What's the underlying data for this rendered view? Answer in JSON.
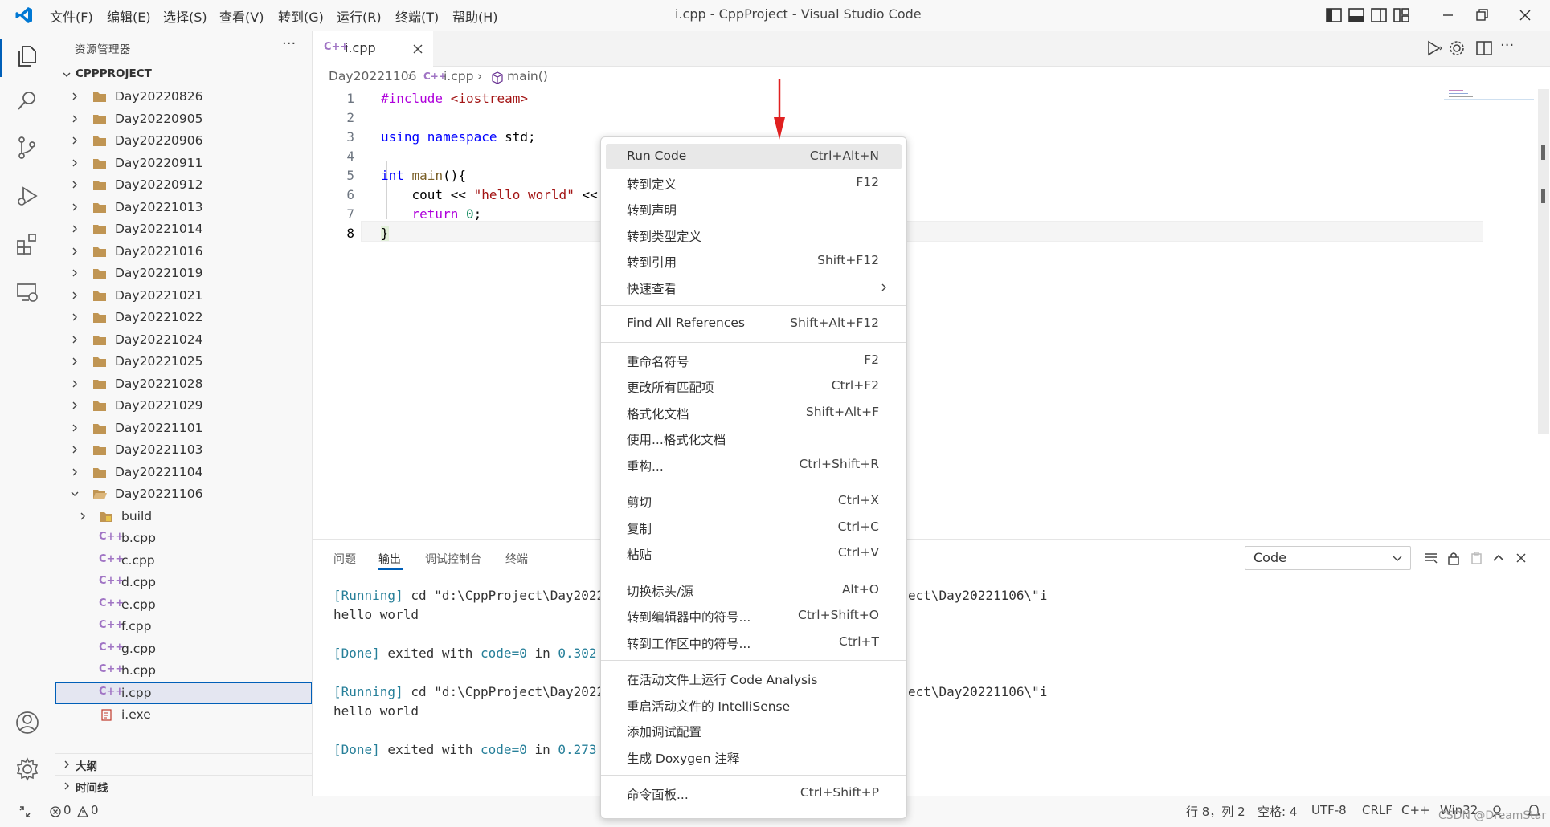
{
  "titlebar": {
    "title": "i.cpp - CppProject - Visual Studio Code",
    "menu": [
      "文件(F)",
      "编辑(E)",
      "选择(S)",
      "查看(V)",
      "转到(G)",
      "运行(R)",
      "终端(T)",
      "帮助(H)"
    ]
  },
  "sidebar": {
    "title": "资源管理器",
    "more": "···",
    "root": "CPPPROJECT",
    "folders": [
      "Day20220826",
      "Day20220905",
      "Day20220906",
      "Day20220911",
      "Day20220912",
      "Day20221013",
      "Day20221014",
      "Day20221016",
      "Day20221019",
      "Day20221021",
      "Day20221022",
      "Day20221024",
      "Day20221025",
      "Day20221028",
      "Day20221029",
      "Day20221101",
      "Day20221103",
      "Day20221104"
    ],
    "open_folder": "Day20221106",
    "build": "build",
    "files": [
      "b.cpp",
      "c.cpp",
      "d.cpp",
      "e.cpp",
      "f.cpp",
      "g.cpp",
      "h.cpp",
      "i.cpp"
    ],
    "exe": "i.exe",
    "outline": "大纲",
    "timeline": "时间线"
  },
  "editor": {
    "tab": "i.cpp",
    "breadcrumb": [
      "Day20221106",
      "i.cpp",
      "main()"
    ],
    "lines": [
      {
        "n": "1"
      },
      {
        "n": "2"
      },
      {
        "n": "3"
      },
      {
        "n": "4"
      },
      {
        "n": "5"
      },
      {
        "n": "6"
      },
      {
        "n": "7"
      },
      {
        "n": "8"
      }
    ],
    "code": {
      "l1_kw": "#include",
      "l1_inc": " <iostream>",
      "l3_a": "using",
      "l3_b": " namespace",
      "l3_c": " std;",
      "l5_kw": "int",
      "l5_fn": " main",
      "l5_rest": "(){",
      "l6_a": "    cout << ",
      "l6_str": "\"hello world\"",
      "l6_b": " <<",
      "l7_kw": "    return",
      "l7_num": " 0",
      "l7_end": ";",
      "l8": "}"
    }
  },
  "panel": {
    "tabs": [
      "问题",
      "输出",
      "调试控制台",
      "终端"
    ],
    "output_channel": "Code",
    "output": {
      "r1_tag": "[Running]",
      "r1_cmd": " cd \"d:\\CppProject\\Day2022",
      "r1_tail": "ect\\Day20221106\\\"i",
      "hello1": "hello world",
      "d1_tag": "[Done]",
      "d1_text": " exited with ",
      "d1_code": "code=0",
      "d1_in": " in ",
      "d1_num": "0.302",
      "r2_tag": "[Running]",
      "r2_cmd": " cd \"d:\\CppProject\\Day2022",
      "r2_tail": "ect\\Day20221106\\\"i",
      "hello2": "hello world",
      "d2_tag": "[Done]",
      "d2_text": " exited with ",
      "d2_code": "code=0",
      "d2_in": " in ",
      "d2_num": "0.273"
    }
  },
  "context_menu": {
    "groups": [
      [
        {
          "label": "Run Code",
          "key": "Ctrl+Alt+N"
        },
        {
          "label": "转到定义",
          "key": "F12"
        },
        {
          "label": "转到声明",
          "key": ""
        },
        {
          "label": "转到类型定义",
          "key": ""
        },
        {
          "label": "转到引用",
          "key": "Shift+F12"
        },
        {
          "label": "快速查看",
          "key": ""
        }
      ],
      [
        {
          "label": "Find All References",
          "key": "Shift+Alt+F12"
        }
      ],
      [
        {
          "label": "重命名符号",
          "key": "F2"
        },
        {
          "label": "更改所有匹配项",
          "key": "Ctrl+F2"
        },
        {
          "label": "格式化文档",
          "key": "Shift+Alt+F"
        },
        {
          "label": "使用...格式化文档",
          "key": ""
        },
        {
          "label": "重构...",
          "key": "Ctrl+Shift+R"
        }
      ],
      [
        {
          "label": "剪切",
          "key": "Ctrl+X"
        },
        {
          "label": "复制",
          "key": "Ctrl+C"
        },
        {
          "label": "粘贴",
          "key": "Ctrl+V"
        }
      ],
      [
        {
          "label": "切换标头/源",
          "key": "Alt+O"
        },
        {
          "label": "转到编辑器中的符号...",
          "key": "Ctrl+Shift+O"
        },
        {
          "label": "转到工作区中的符号...",
          "key": "Ctrl+T"
        }
      ],
      [
        {
          "label": "在活动文件上运行 Code Analysis",
          "key": ""
        },
        {
          "label": "重启活动文件的 IntelliSense",
          "key": ""
        },
        {
          "label": "添加调试配置",
          "key": ""
        },
        {
          "label": "生成 Doxygen 注释",
          "key": ""
        }
      ],
      [
        {
          "label": "命令面板...",
          "key": "Ctrl+Shift+P"
        }
      ]
    ]
  },
  "statusbar": {
    "errors": "0",
    "warnings": "0",
    "position": "行 8，列 2",
    "spaces": "空格: 4",
    "encoding": "UTF-8",
    "eol": "CRLF",
    "language": "C++",
    "platform": "Win32",
    "watermark": "CSDN @DreamStar"
  },
  "colors": {
    "accent": "#005fb8",
    "vscode_blue": "#0078d4",
    "arrow": "#e02020",
    "cpp_icon": "#a074c4",
    "folder": "#c09553"
  }
}
